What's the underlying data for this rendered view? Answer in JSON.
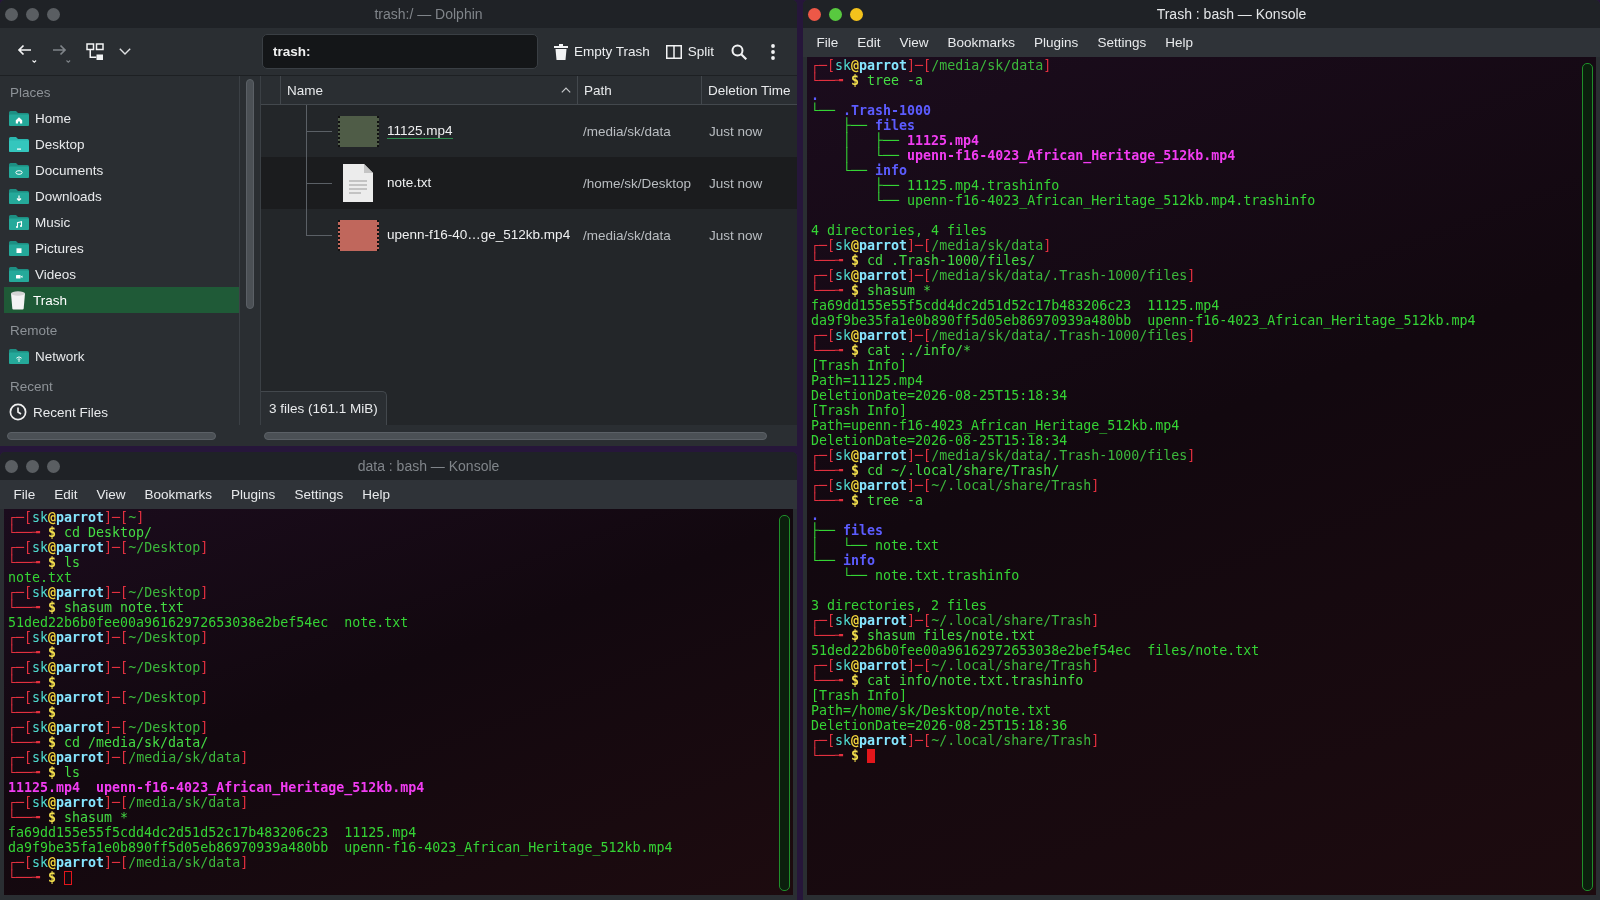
{
  "file_manager": {
    "window": {
      "title": "trash:/ — Dolphin",
      "focused": false
    },
    "toolbar": {
      "navigation": [
        {
          "kind": "back",
          "disabled": false
        },
        {
          "kind": "forward",
          "disabled": true
        }
      ],
      "location": "trash:",
      "buttons": [
        {
          "kind": "trash",
          "label": "Empty Trash"
        },
        {
          "kind": "split",
          "label": "Split"
        }
      ]
    },
    "sidebar": [
      {
        "title": "Places",
        "items": [
          {
            "kind": "home",
            "label": "Home",
            "selected": false
          },
          {
            "kind": "desktop",
            "label": "Desktop",
            "selected": false
          },
          {
            "kind": "documents",
            "label": "Documents",
            "selected": false
          },
          {
            "kind": "downloads",
            "label": "Downloads",
            "selected": false
          },
          {
            "kind": "music",
            "label": "Music",
            "selected": false
          },
          {
            "kind": "pictures",
            "label": "Pictures",
            "selected": false
          },
          {
            "kind": "videos",
            "label": "Videos",
            "selected": false
          },
          {
            "kind": "trash",
            "label": "Trash",
            "selected": true
          }
        ]
      },
      {
        "title": "Remote",
        "items": [
          {
            "kind": "network",
            "label": "Network",
            "selected": false
          }
        ]
      },
      {
        "title": "Recent",
        "items": [
          {
            "kind": "recent",
            "label": "Recent Files",
            "selected": false
          }
        ]
      }
    ],
    "files": {
      "columns": [
        {
          "label": "Name",
          "sorted": true
        },
        {
          "label": "Path",
          "sorted": false
        },
        {
          "label": "Deletion Time",
          "sorted": false
        }
      ],
      "rows": [
        {
          "kind": "video",
          "name": "11125.mp4",
          "path": "/media/sk/data",
          "deletion_time": "Just now",
          "color": "#4f5c47",
          "focused": true
        },
        {
          "kind": "text",
          "name": "note.txt",
          "path": "/home/sk/Desktop",
          "deletion_time": "Just now",
          "focused": false
        },
        {
          "kind": "video",
          "name": "upenn-f16-40…ge_512kb.mp4",
          "path": "/media/sk/data",
          "deletion_time": "Just now",
          "color": "#c0675c",
          "focused": false
        }
      ]
    },
    "status_bar": "3 files (161.1 MiB)"
  },
  "terminal_left": {
    "window": {
      "title": "data : bash — Konsole",
      "focused": false
    },
    "menu": [
      "File",
      "Edit",
      "View",
      "Bookmarks",
      "Plugins",
      "Settings",
      "Help"
    ],
    "cursor": true,
    "lines": [
      {
        "kind": "prompt",
        "text": [
          "┌─[",
          "sk",
          "@",
          "parrot",
          "]─[",
          "~",
          "]"
        ]
      },
      {
        "kind": "command",
        "text": [
          "└──╼ ",
          "$ ",
          "cd Desktop/"
        ]
      },
      {
        "kind": "prompt",
        "text": [
          "┌─[",
          "sk",
          "@",
          "parrot",
          "]─[",
          "~/Desktop",
          "]"
        ]
      },
      {
        "kind": "command",
        "text": [
          "└──╼ ",
          "$ ",
          "ls"
        ]
      },
      {
        "kind": "output",
        "text": "note.txt"
      },
      {
        "kind": "prompt",
        "text": [
          "┌─[",
          "sk",
          "@",
          "parrot",
          "]─[",
          "~/Desktop",
          "]"
        ]
      },
      {
        "kind": "command",
        "text": [
          "└──╼ ",
          "$ ",
          "shasum note.txt"
        ]
      },
      {
        "kind": "output",
        "text": "51ded22b6b0fee00a96162972653038e2bef54ec  note.txt"
      },
      {
        "kind": "prompt",
        "text": [
          "┌─[",
          "sk",
          "@",
          "parrot",
          "]─[",
          "~/Desktop",
          "]"
        ]
      },
      {
        "kind": "command",
        "text": [
          "└──╼ ",
          "$"
        ]
      },
      {
        "kind": "prompt",
        "text": [
          "┌─[",
          "sk",
          "@",
          "parrot",
          "]─[",
          "~/Desktop",
          "]"
        ]
      },
      {
        "kind": "command",
        "text": [
          "└──╼ ",
          "$"
        ]
      },
      {
        "kind": "prompt",
        "text": [
          "┌─[",
          "sk",
          "@",
          "parrot",
          "]─[",
          "~/Desktop",
          "]"
        ]
      },
      {
        "kind": "command",
        "text": [
          "└──╼ ",
          "$"
        ]
      },
      {
        "kind": "prompt",
        "text": [
          "┌─[",
          "sk",
          "@",
          "parrot",
          "]─[",
          "~/Desktop",
          "]"
        ]
      },
      {
        "kind": "command",
        "text": [
          "└──╼ ",
          "$ ",
          "cd /media/sk/data/"
        ]
      },
      {
        "kind": "prompt",
        "text": [
          "┌─[",
          "sk",
          "@",
          "parrot",
          "]─[",
          "/media/sk/data",
          "]"
        ]
      },
      {
        "kind": "command",
        "text": [
          "└──╼ ",
          "$ ",
          "ls"
        ]
      },
      {
        "kind": "listing",
        "text": "11125.mp4  upenn-f16-4023_African_Heritage_512kb.mp4"
      },
      {
        "kind": "prompt",
        "text": [
          "┌─[",
          "sk",
          "@",
          "parrot",
          "]─[",
          "/media/sk/data",
          "]"
        ]
      },
      {
        "kind": "command",
        "text": [
          "└──╼ ",
          "$ ",
          "shasum *"
        ]
      },
      {
        "kind": "output",
        "text": "fa69dd155e55f5cdd4dc2d51d52c17b483206c23  11125.mp4"
      },
      {
        "kind": "output",
        "text": "da9f9be35fa1e0b890ff5d05eb86970939a480bb  upenn-f16-4023_African_Heritage_512kb.mp4"
      },
      {
        "kind": "prompt",
        "text": [
          "┌─[",
          "sk",
          "@",
          "parrot",
          "]─[",
          "/media/sk/data",
          "]"
        ]
      },
      {
        "kind": "command",
        "text": [
          "└──╼ ",
          "$"
        ]
      }
    ]
  },
  "terminal_right": {
    "window": {
      "title": "Trash : bash — Konsole",
      "focused": true
    },
    "menu": [
      "File",
      "Edit",
      "View",
      "Bookmarks",
      "Plugins",
      "Settings",
      "Help"
    ],
    "cursor": true,
    "lines": [
      {
        "kind": "prompt",
        "text": [
          "┌─[",
          "sk",
          "@",
          "parrot",
          "]─[",
          "/media/sk/data",
          "]"
        ]
      },
      {
        "kind": "command",
        "text": [
          "└──╼ ",
          "$ ",
          "tree -a"
        ]
      },
      {
        "kind": "folder",
        "text": [
          "."
        ]
      },
      {
        "kind": "folder",
        "text": [
          "└── ",
          ".Trash-1000"
        ]
      },
      {
        "kind": "folder",
        "text": [
          "    ├── ",
          "files"
        ]
      },
      {
        "kind": "video",
        "text": [
          "    │   ├── ",
          "11125.mp4"
        ]
      },
      {
        "kind": "video",
        "text": [
          "    │   └── ",
          "upenn-f16-4023_African_Heritage_512kb.mp4"
        ]
      },
      {
        "kind": "folder",
        "text": [
          "    └── ",
          "info"
        ]
      },
      {
        "kind": "file",
        "text": [
          "        ├── ",
          "11125.mp4.trashinfo"
        ]
      },
      {
        "kind": "file",
        "text": [
          "        └── ",
          "upenn-f16-4023_African_Heritage_512kb.mp4.trashinfo"
        ]
      },
      {
        "kind": "blank"
      },
      {
        "kind": "output",
        "text": "4 directories, 4 files"
      },
      {
        "kind": "prompt",
        "text": [
          "┌─[",
          "sk",
          "@",
          "parrot",
          "]─[",
          "/media/sk/data",
          "]"
        ]
      },
      {
        "kind": "command",
        "text": [
          "└──╼ ",
          "$ ",
          "cd .Trash-1000/files/"
        ]
      },
      {
        "kind": "prompt",
        "text": [
          "┌─[",
          "sk",
          "@",
          "parrot",
          "]─[",
          "/media/sk/data/.Trash-1000/files",
          "]"
        ]
      },
      {
        "kind": "command",
        "text": [
          "└──╼ ",
          "$ ",
          "shasum *"
        ]
      },
      {
        "kind": "output",
        "text": "fa69dd155e55f5cdd4dc2d51d52c17b483206c23  11125.mp4"
      },
      {
        "kind": "output",
        "text": "da9f9be35fa1e0b890ff5d05eb86970939a480bb  upenn-f16-4023_African_Heritage_512kb.mp4"
      },
      {
        "kind": "prompt",
        "text": [
          "┌─[",
          "sk",
          "@",
          "parrot",
          "]─[",
          "/media/sk/data/.Trash-1000/files",
          "]"
        ]
      },
      {
        "kind": "command",
        "text": [
          "└──╼ ",
          "$ ",
          "cat ../info/*"
        ]
      },
      {
        "kind": "output",
        "text": "[Trash Info]"
      },
      {
        "kind": "output",
        "text": "Path=11125.mp4"
      },
      {
        "kind": "output",
        "text": "DeletionDate=2026-08-25T15:18:34"
      },
      {
        "kind": "output",
        "text": "[Trash Info]"
      },
      {
        "kind": "output",
        "text": "Path=upenn-f16-4023_African_Heritage_512kb.mp4"
      },
      {
        "kind": "output",
        "text": "DeletionDate=2026-08-25T15:18:34"
      },
      {
        "kind": "prompt",
        "text": [
          "┌─[",
          "sk",
          "@",
          "parrot",
          "]─[",
          "/media/sk/data/.Trash-1000/files",
          "]"
        ]
      },
      {
        "kind": "command",
        "text": [
          "└──╼ ",
          "$ ",
          "cd ~/.local/share/Trash/"
        ]
      },
      {
        "kind": "prompt",
        "text": [
          "┌─[",
          "sk",
          "@",
          "parrot",
          "]─[",
          "~/.local/share/Trash",
          "]"
        ]
      },
      {
        "kind": "command",
        "text": [
          "└──╼ ",
          "$ ",
          "tree -a"
        ]
      },
      {
        "kind": "folder",
        "text": [
          "."
        ]
      },
      {
        "kind": "folder",
        "text": [
          "├── ",
          "files"
        ]
      },
      {
        "kind": "file",
        "text": [
          "│   └── ",
          "note.txt"
        ]
      },
      {
        "kind": "folder",
        "text": [
          "└── ",
          "info"
        ]
      },
      {
        "kind": "file",
        "text": [
          "    └── ",
          "note.txt.trashinfo"
        ]
      },
      {
        "kind": "blank"
      },
      {
        "kind": "output",
        "text": "3 directories, 2 files"
      },
      {
        "kind": "prompt",
        "text": [
          "┌─[",
          "sk",
          "@",
          "parrot",
          "]─[",
          "~/.local/share/Trash",
          "]"
        ]
      },
      {
        "kind": "command",
        "text": [
          "└──╼ ",
          "$ ",
          "shasum files/note.txt"
        ]
      },
      {
        "kind": "output",
        "text": "51ded22b6b0fee00a96162972653038e2bef54ec  files/note.txt"
      },
      {
        "kind": "prompt",
        "text": [
          "┌─[",
          "sk",
          "@",
          "parrot",
          "]─[",
          "~/.local/share/Trash",
          "]"
        ]
      },
      {
        "kind": "command",
        "text": [
          "└──╼ ",
          "$ ",
          "cat info/note.txt.trashinfo"
        ]
      },
      {
        "kind": "output",
        "text": "[Trash Info]"
      },
      {
        "kind": "output",
        "text": "Path=/home/sk/Desktop/note.txt"
      },
      {
        "kind": "output",
        "text": "DeletionDate=2026-08-25T15:18:36"
      },
      {
        "kind": "prompt",
        "text": [
          "┌─[",
          "sk",
          "@",
          "parrot",
          "]─[",
          "~/.local/share/Trash",
          "]"
        ]
      },
      {
        "kind": "command",
        "text": [
          "└──╼ ",
          "$"
        ]
      }
    ]
  }
}
